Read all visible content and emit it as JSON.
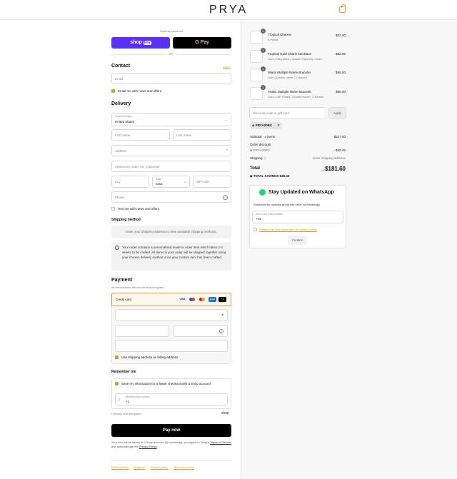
{
  "header": {
    "logo": "PRYA",
    "bag_icon": "shopping-bag-icon"
  },
  "express": {
    "label": "Express checkout",
    "shoppay": "shop",
    "shoppay_pay": "Pay",
    "gpay": "Pay",
    "or": "OR"
  },
  "contact": {
    "title": "Contact",
    "login": "Log in",
    "email_placeholder": "Email",
    "news_label": "Email me with news and offers"
  },
  "delivery": {
    "title": "Delivery",
    "country_label": "Country/Region",
    "country": "United States",
    "first": "First name",
    "last": "Last name",
    "address": "Address",
    "apt": "Apartment, suite, etc. (optional)",
    "city": "City",
    "state_label": "State",
    "state": "Iowa",
    "zip": "ZIP code",
    "phone": "Phone",
    "text_label": "Text me with news and offers"
  },
  "shipping": {
    "title": "Shipping method",
    "placeholder": "Enter your shipping address to view available shipping methods.",
    "notice": "Your order contains a personalised made to order item which takes 2-4 weeks to be crafted. All items in your order will be shipped together using your chosen delivery method once your custom item has been crafted."
  },
  "payment": {
    "title": "Payment",
    "subtitle": "All transactions are secure and encrypted.",
    "method": "Credit card",
    "cards": [
      "VISA",
      "",
      "",
      "AMEX",
      "+4"
    ],
    "billing_label": "Use shipping address as billing address"
  },
  "remember": {
    "title": "Remember me",
    "save_label": "Save my information for a faster checkout with a Shop account",
    "mobile_label": "Mobile phone number",
    "mobile_value": "+1",
    "secure": "Secure and encrypted",
    "shop": "shop"
  },
  "pay_button": "Pay now",
  "legal": {
    "text": "Your info will be saved to a Shop account. By continuing, you agree to Shop's",
    "tos": "Terms of Service",
    "and": "and acknowledge the",
    "privacy": "Privacy Policy"
  },
  "footer_links": [
    "Refund policy",
    "Shipping",
    "Privacy policy",
    "Terms of service"
  ],
  "items": [
    {
      "qty": "1",
      "name": "Tropical Charms",
      "variant": "3 Pearls",
      "price": "$33.00"
    },
    {
      "qty": "1",
      "name": "Tropical Gold Charm Necklace",
      "variant": "Gold | 18k plated | Classic Paperclip Chain",
      "price": "$62.00"
    },
    {
      "qty": "1",
      "name": "Miami Multiple Name Bracelet",
      "variant": "Gold | Double name | 2 Names",
      "price": "$66.00"
    },
    {
      "qty": "1",
      "name": "Arabic Multiple Name Bracelet",
      "variant": "Gold | 18K Plated | Double Name | 2 Names",
      "price": "$66.00"
    }
  ],
  "discount": {
    "placeholder": "Discount code or gift card",
    "apply": "Apply",
    "code": "PRYA20RX"
  },
  "summary": {
    "subtotal_label": "Subtotal · 4 items",
    "subtotal": "$227.00",
    "order_discount": "Order discount",
    "code": "PRYA20RX",
    "discount_value": "- $45.40",
    "shipping_label": "Shipping",
    "shipping_value": "Enter shipping address",
    "total_label": "Total",
    "currency": "USD",
    "total": "$181.60",
    "savings_label": "TOTAL SAVINGS",
    "savings": "$45.40"
  },
  "whatsapp": {
    "title": "Stay Updated on WhatsApp",
    "subtitle": "Subscribe for updates about this order via Whatsapp",
    "number_label": "Enter your order number",
    "number_value": "+44",
    "consent": "Please read and agree with our privacy policy",
    "confirm": "Confirm"
  },
  "colors": {
    "accent": "#c9a13b",
    "shoppay": "#5a31f4",
    "whatsapp": "#25d366"
  }
}
